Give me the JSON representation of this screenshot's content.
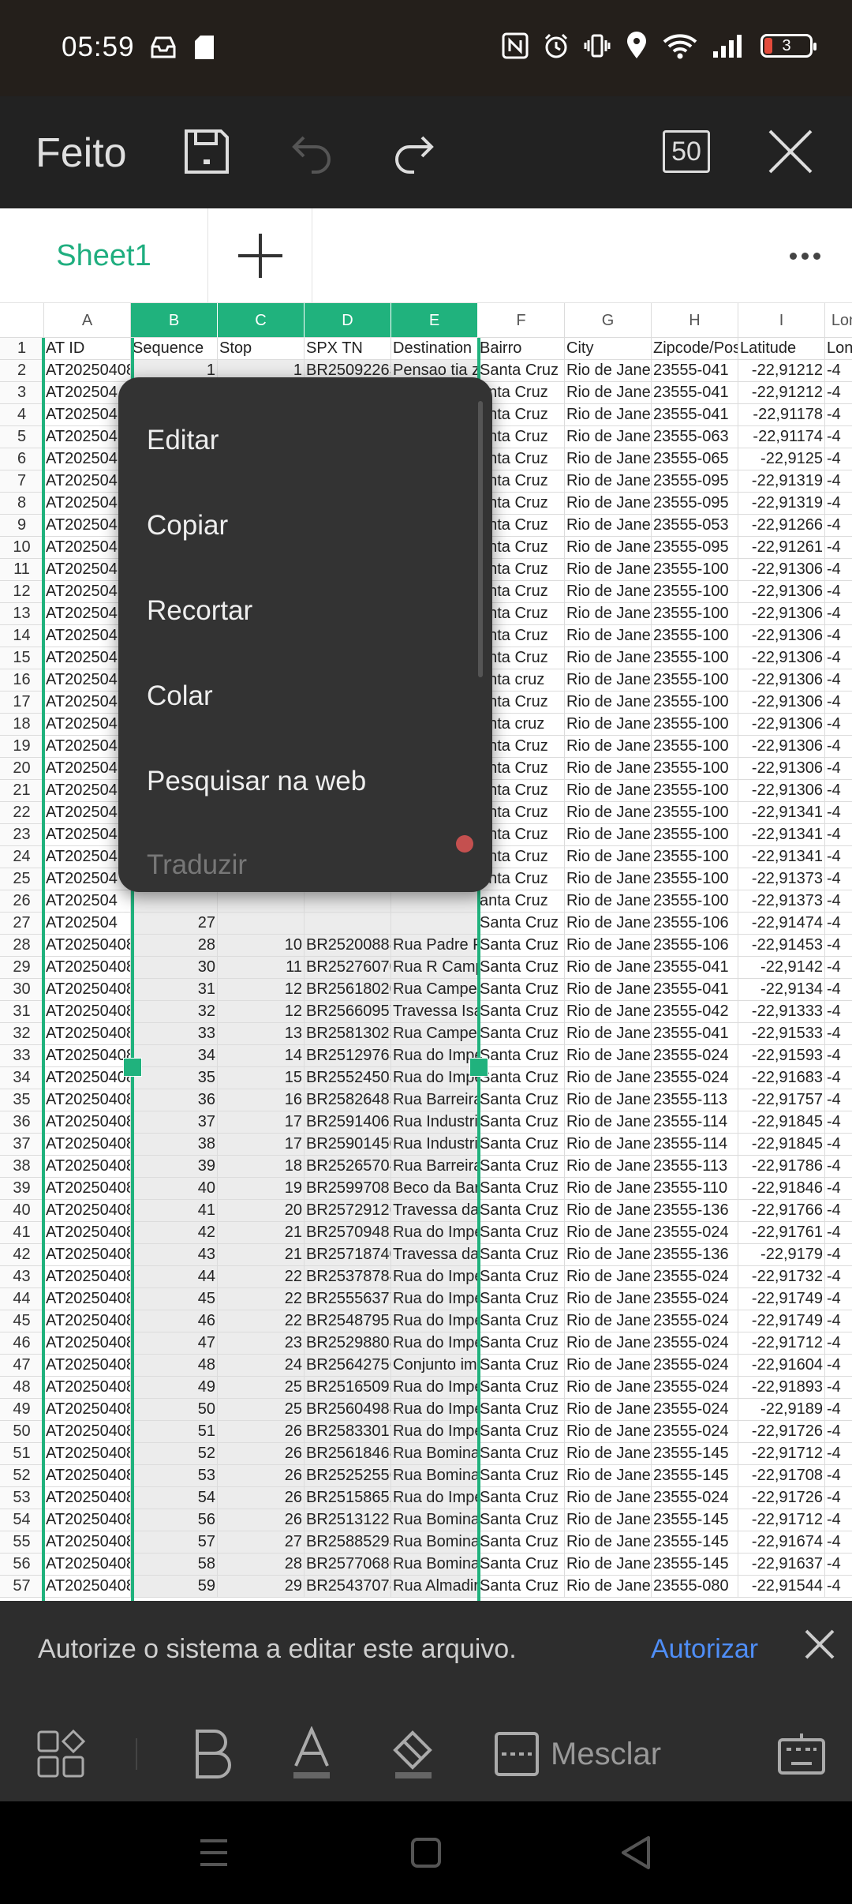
{
  "status_bar": {
    "time": "05:59",
    "battery": "3"
  },
  "toolbar": {
    "done_label": "Feito",
    "zoom_value": "50"
  },
  "sheet_tabs": {
    "active_sheet": "Sheet1"
  },
  "grid": {
    "column_letters": [
      "A",
      "B",
      "C",
      "D",
      "E",
      "F",
      "G",
      "H",
      "I",
      "Lon"
    ],
    "selected_columns": [
      "B",
      "C",
      "D",
      "E"
    ],
    "header_row": {
      "row": "1",
      "cells": [
        "AT ID",
        "Sequence",
        "Stop",
        "SPX TN",
        "Destination",
        "Bairro",
        "City",
        "Zipcode/Pos",
        "Latitude",
        "Lon"
      ]
    },
    "rows": [
      [
        "2",
        "AT20250408",
        "1",
        "1",
        "BR25092263",
        "Pensao tia z",
        "Santa Cruz",
        "Rio de Janei",
        "23555-041",
        "-22,91212"
      ],
      [
        "3",
        "AT202504",
        "",
        "",
        "",
        "",
        "anta Cruz",
        "Rio de Janei",
        "23555-041",
        "-22,91212"
      ],
      [
        "4",
        "AT202504",
        "",
        "",
        "",
        "",
        "anta Cruz",
        "Rio de Janei",
        "23555-041",
        "-22,91178"
      ],
      [
        "5",
        "AT202504",
        "",
        "",
        "",
        "",
        "anta Cruz",
        "Rio de Janei",
        "23555-063",
        "-22,91174"
      ],
      [
        "6",
        "AT202504",
        "",
        "",
        "",
        "",
        "anta Cruz",
        "Rio de Janei",
        "23555-065",
        "-22,9125"
      ],
      [
        "7",
        "AT202504",
        "",
        "",
        "",
        "",
        "anta Cruz",
        "Rio de Janei",
        "23555-095",
        "-22,91319"
      ],
      [
        "8",
        "AT202504",
        "",
        "",
        "",
        "",
        "anta Cruz",
        "Rio de Janei",
        "23555-095",
        "-22,91319"
      ],
      [
        "9",
        "AT202504",
        "",
        "",
        "",
        "",
        "anta Cruz",
        "Rio de Janei",
        "23555-053",
        "-22,91266"
      ],
      [
        "10",
        "AT202504",
        "",
        "",
        "",
        "",
        "anta Cruz",
        "Rio de Janei",
        "23555-095",
        "-22,91261"
      ],
      [
        "11",
        "AT202504",
        "",
        "",
        "",
        "",
        "anta Cruz",
        "Rio de Janei",
        "23555-100",
        "-22,91306"
      ],
      [
        "12",
        "AT202504",
        "",
        "",
        "",
        "",
        "anta Cruz",
        "Rio de Janei",
        "23555-100",
        "-22,91306"
      ],
      [
        "13",
        "AT202504",
        "",
        "",
        "",
        "",
        "anta Cruz",
        "Rio de Janei",
        "23555-100",
        "-22,91306"
      ],
      [
        "14",
        "AT202504",
        "",
        "",
        "",
        "",
        "anta Cruz",
        "Rio de Janei",
        "23555-100",
        "-22,91306"
      ],
      [
        "15",
        "AT202504",
        "",
        "",
        "",
        "",
        "anta Cruz",
        "Rio de Janei",
        "23555-100",
        "-22,91306"
      ],
      [
        "16",
        "AT202504",
        "",
        "",
        "",
        "",
        "anta cruz",
        "Rio de Janei",
        "23555-100",
        "-22,91306"
      ],
      [
        "17",
        "AT202504",
        "",
        "",
        "",
        "",
        "anta Cruz",
        "Rio de Janei",
        "23555-100",
        "-22,91306"
      ],
      [
        "18",
        "AT202504",
        "",
        "",
        "",
        "",
        "anta cruz",
        "Rio de Janei",
        "23555-100",
        "-22,91306"
      ],
      [
        "19",
        "AT202504",
        "",
        "",
        "",
        "",
        "anta Cruz",
        "Rio de Janei",
        "23555-100",
        "-22,91306"
      ],
      [
        "20",
        "AT202504",
        "",
        "",
        "",
        "",
        "anta Cruz",
        "Rio de Janei",
        "23555-100",
        "-22,91306"
      ],
      [
        "21",
        "AT202504",
        "",
        "",
        "",
        "",
        "anta Cruz",
        "Rio de Janei",
        "23555-100",
        "-22,91306"
      ],
      [
        "22",
        "AT202504",
        "",
        "",
        "",
        "",
        "anta Cruz",
        "Rio de Janei",
        "23555-100",
        "-22,91341"
      ],
      [
        "23",
        "AT202504",
        "",
        "",
        "",
        "",
        "anta Cruz",
        "Rio de Janei",
        "23555-100",
        "-22,91341"
      ],
      [
        "24",
        "AT202504",
        "",
        "",
        "",
        "",
        "anta Cruz",
        "Rio de Janei",
        "23555-100",
        "-22,91341"
      ],
      [
        "25",
        "AT202504",
        "",
        "",
        "",
        "",
        "anta Cruz",
        "Rio de Janei",
        "23555-100",
        "-22,91373"
      ],
      [
        "26",
        "AT202504",
        "",
        "",
        "",
        "",
        "anta Cruz",
        "Rio de Janei",
        "23555-100",
        "-22,91373"
      ],
      [
        "27",
        "AT202504",
        "27",
        "",
        "",
        "",
        "Santa Cruz",
        "Rio de Janei",
        "23555-106",
        "-22,91474"
      ],
      [
        "28",
        "AT20250408",
        "28",
        "10",
        "BR25200888",
        "Rua Padre P",
        "Santa Cruz",
        "Rio de Janei",
        "23555-106",
        "-22,91453"
      ],
      [
        "29",
        "AT20250408",
        "30",
        "11",
        "BR25276070",
        "Rua R Camp",
        "Santa Cruz",
        "Rio de Janei",
        "23555-041",
        "-22,9142"
      ],
      [
        "30",
        "AT20250408",
        "31",
        "12",
        "BR25618020",
        "Rua Campei",
        "Santa Cruz",
        "Rio de Janei",
        "23555-041",
        "-22,9134"
      ],
      [
        "31",
        "AT20250408",
        "32",
        "12",
        "BR25660957",
        "Travessa Isa",
        "Santa Cruz",
        "Rio de Janei",
        "23555-042",
        "-22,91333"
      ],
      [
        "32",
        "AT20250408",
        "33",
        "13",
        "BR25813023",
        "Rua Campei",
        "Santa Cruz",
        "Rio de Janei",
        "23555-041",
        "-22,91533"
      ],
      [
        "33",
        "AT20250408",
        "34",
        "14",
        "BR25129768",
        "Rua do Impe",
        "Santa Cruz",
        "Rio de Janei",
        "23555-024",
        "-22,91593"
      ],
      [
        "34",
        "AT20250408",
        "35",
        "15",
        "BR25524503",
        "Rua do Impe",
        "Santa Cruz",
        "Rio de Janei",
        "23555-024",
        "-22,91683"
      ],
      [
        "35",
        "AT20250408",
        "36",
        "16",
        "BR25826485",
        "Rua Barreira",
        "Santa Cruz",
        "Rio de Janei",
        "23555-113",
        "-22,91757"
      ],
      [
        "36",
        "AT20250408",
        "37",
        "17",
        "BR25914062",
        "Rua Industri",
        "Santa Cruz",
        "Rio de Janei",
        "23555-114",
        "-22,91845"
      ],
      [
        "37",
        "AT20250408",
        "38",
        "17",
        "BR25901450",
        "Rua Industri",
        "Santa Cruz",
        "Rio de Janei",
        "23555-114",
        "-22,91845"
      ],
      [
        "38",
        "AT20250408",
        "39",
        "18",
        "BR25265704",
        "Rua Barreira",
        "Santa Cruz",
        "Rio de Janei",
        "23555-113",
        "-22,91786"
      ],
      [
        "39",
        "AT20250408",
        "40",
        "19",
        "BR25997081",
        "Beco da Bar",
        "Santa Cruz",
        "Rio de Janei",
        "23555-110",
        "-22,91846"
      ],
      [
        "40",
        "AT20250408",
        "41",
        "20",
        "BR25729126",
        "Travessa da",
        "Santa Cruz",
        "Rio de Janei",
        "23555-136",
        "-22,91766"
      ],
      [
        "41",
        "AT20250408",
        "42",
        "21",
        "BR25709482",
        "Rua do Impe",
        "Santa Cruz",
        "Rio de Janei",
        "23555-024",
        "-22,91761"
      ],
      [
        "42",
        "AT20250408",
        "43",
        "21",
        "BR25718740",
        "Travessa da",
        "Santa Cruz",
        "Rio de Janei",
        "23555-136",
        "-22,9179"
      ],
      [
        "43",
        "AT20250408",
        "44",
        "22",
        "BR25378784",
        "Rua do Impe",
        "Santa Cruz",
        "Rio de Janei",
        "23555-024",
        "-22,91732"
      ],
      [
        "44",
        "AT20250408",
        "45",
        "22",
        "BR25556377",
        "Rua do Impe",
        "Santa Cruz",
        "Rio de Janei",
        "23555-024",
        "-22,91749"
      ],
      [
        "45",
        "AT20250408",
        "46",
        "22",
        "BR25487952",
        "Rua do Impe",
        "Santa Cruz",
        "Rio de Janei",
        "23555-024",
        "-22,91749"
      ],
      [
        "46",
        "AT20250408",
        "47",
        "23",
        "BR25298808",
        "Rua do Impe",
        "Santa Cruz",
        "Rio de Janei",
        "23555-024",
        "-22,91712"
      ],
      [
        "47",
        "AT20250408",
        "48",
        "24",
        "BR25642756",
        "Conjunto im",
        "Santa Cruz",
        "Rio de Janei",
        "23555-024",
        "-22,91604"
      ],
      [
        "48",
        "AT20250408",
        "49",
        "25",
        "BR25165093",
        "Rua do Impe",
        "Santa Cruz",
        "Rio de Janei",
        "23555-024",
        "-22,91893"
      ],
      [
        "49",
        "AT20250408",
        "50",
        "25",
        "BR25604988",
        "Rua do Impe",
        "Santa Cruz",
        "Rio de Janei",
        "23555-024",
        "-22,9189"
      ],
      [
        "50",
        "AT20250408",
        "51",
        "26",
        "BR25833017",
        "Rua do Impe",
        "Santa Cruz",
        "Rio de Janei",
        "23555-024",
        "-22,91726"
      ],
      [
        "51",
        "AT20250408",
        "52",
        "26",
        "BR25618468",
        "Rua Bomina",
        "Santa Cruz",
        "Rio de Janei",
        "23555-145",
        "-22,91712"
      ],
      [
        "52",
        "AT20250408",
        "53",
        "26",
        "BR25252556",
        "Rua Bomina",
        "Santa Cruz",
        "Rio de Janei",
        "23555-145",
        "-22,91708"
      ],
      [
        "53",
        "AT20250408",
        "54",
        "26",
        "BR25158652",
        "Rua do Impe",
        "Santa Cruz",
        "Rio de Janei",
        "23555-024",
        "-22,91726"
      ],
      [
        "54",
        "AT20250408",
        "56",
        "26",
        "BR25131221",
        "Rua Bomina",
        "Santa Cruz",
        "Rio de Janei",
        "23555-145",
        "-22,91712"
      ],
      [
        "55",
        "AT20250408",
        "57",
        "27",
        "BR25885293",
        "Rua Bomina",
        "Santa Cruz",
        "Rio de Janei",
        "23555-145",
        "-22,91674"
      ],
      [
        "56",
        "AT20250408",
        "58",
        "28",
        "BR25770686",
        "Rua Bomina",
        "Santa Cruz",
        "Rio de Janei",
        "23555-145",
        "-22,91637"
      ],
      [
        "57",
        "AT20250408",
        "59",
        "29",
        "BR25437078",
        "Rua Almadir",
        "Santa Cruz",
        "Rio de Janei",
        "23555-080",
        "-22,91544"
      ]
    ],
    "lon_partial": "-4"
  },
  "context_menu": {
    "items": [
      "Editar",
      "Copiar",
      "Recortar",
      "Colar",
      "Pesquisar na web",
      "Traduzir"
    ]
  },
  "notice": {
    "text": "Autorize o sistema a editar este arquivo.",
    "action": "Autorizar"
  },
  "bottom_bar": {
    "merge_label": "Mesclar"
  },
  "colors": {
    "accent": "#20b27d",
    "link": "#4f8ef7",
    "toolbar_bg": "#222222"
  }
}
